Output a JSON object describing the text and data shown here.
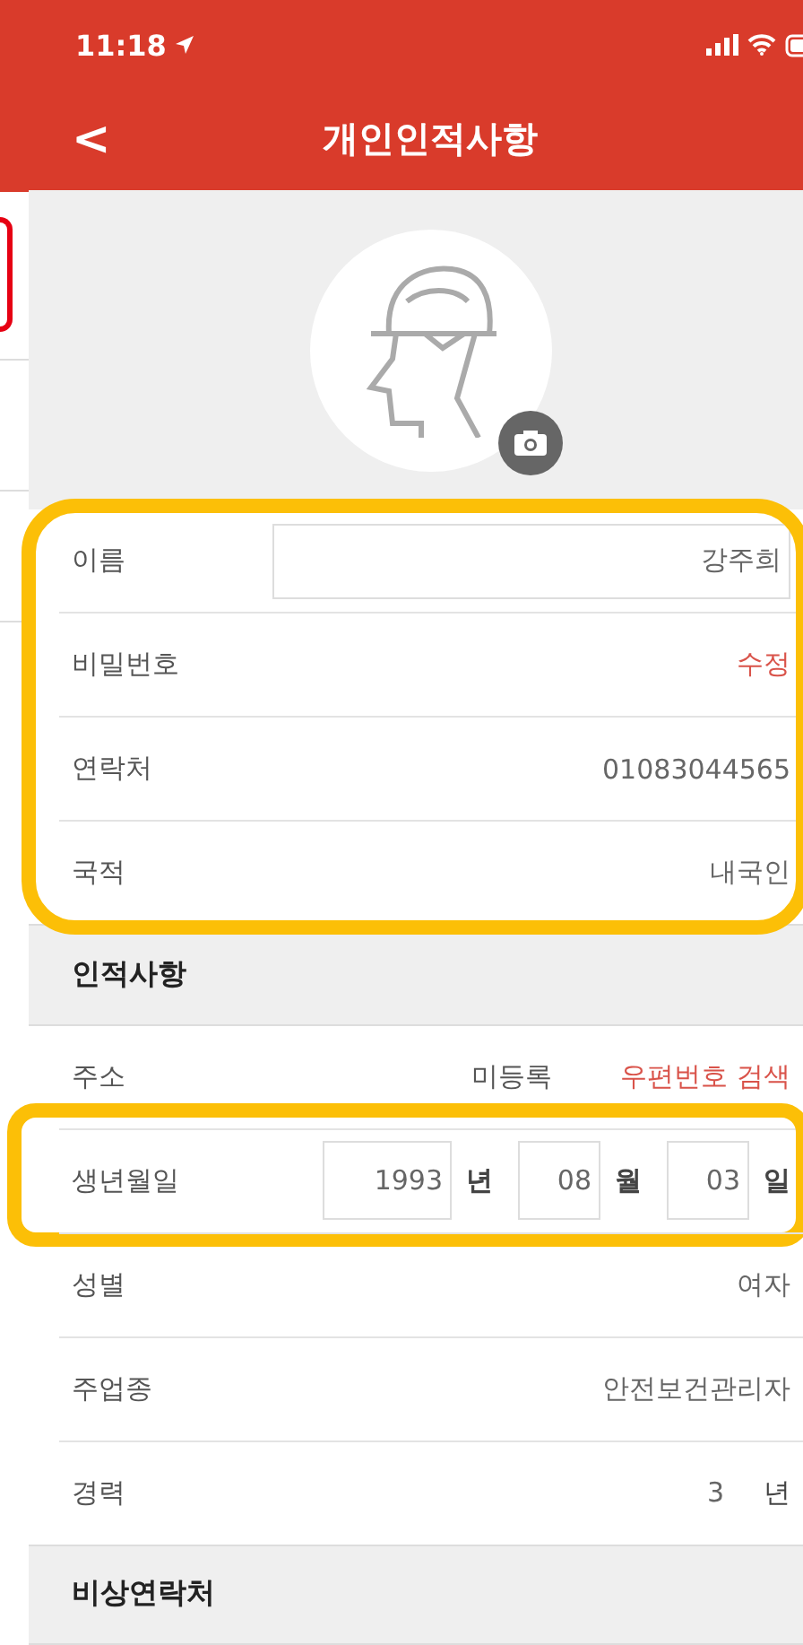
{
  "status_bar": {
    "time": "11:18"
  },
  "nav": {
    "back": "<",
    "title": "개인인적사항"
  },
  "account": {
    "highlighted": true,
    "rows": [
      {
        "label": "이름",
        "kind": "input",
        "value": "강주희"
      },
      {
        "label": "비밀번호",
        "kind": "link",
        "value": "수정"
      },
      {
        "label": "연락처",
        "kind": "text",
        "value": "01083044565"
      },
      {
        "label": "국적",
        "kind": "text",
        "value": "내국인"
      }
    ]
  },
  "sections": [
    {
      "title": "인적사항",
      "rows": [
        {
          "label": "주소",
          "kind": "address",
          "value": "미등록",
          "action": "우편번호 검색",
          "highlighted": false
        },
        {
          "label": "생년월일",
          "kind": "date",
          "highlighted": true,
          "parts": [
            {
              "value": "1993",
              "unit": "년"
            },
            {
              "value": "08",
              "unit": "월"
            },
            {
              "value": "03",
              "unit": "일"
            }
          ]
        },
        {
          "label": "성별",
          "kind": "text",
          "value": "여자",
          "highlighted": false
        },
        {
          "label": "주업종",
          "kind": "text",
          "value": "안전보건관리자",
          "highlighted": false
        },
        {
          "label": "경력",
          "kind": "unit",
          "value": "3",
          "unit": "년",
          "highlighted": false
        }
      ]
    },
    {
      "title": "비상연락처"
    }
  ]
}
